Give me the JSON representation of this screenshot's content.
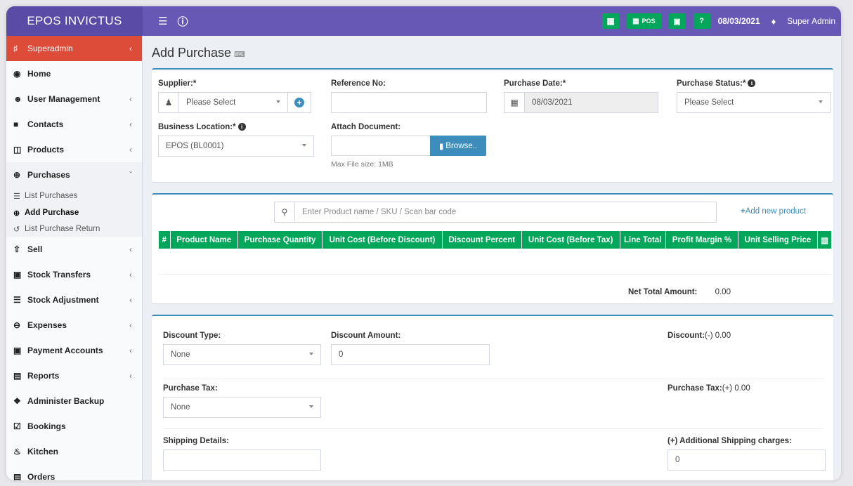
{
  "app": {
    "brand": "EPOS INVICTUS",
    "menu_icon": "hamburger-icon",
    "info_icon": "info-icon"
  },
  "topbar": {
    "calculator_icon": "calculator-icon",
    "pos_label": "POS",
    "cash_icon": "cash-icon",
    "help_icon": "question-icon",
    "date": "08/03/2021",
    "bell_icon": "bell-icon",
    "user": "Super Admin",
    "colors": {
      "bar": "#6758b6",
      "brand": "#5a4ba6",
      "button": "#00a65a"
    }
  },
  "sidebar": {
    "active": "Superadmin",
    "items": [
      {
        "label": "Home",
        "icon": "dashboard-icon",
        "chevron": false
      },
      {
        "label": "User Management",
        "icon": "users-icon",
        "chevron": true
      },
      {
        "label": "Contacts",
        "icon": "address-book-icon",
        "chevron": true
      },
      {
        "label": "Products",
        "icon": "cubes-icon",
        "chevron": true
      },
      {
        "label": "Purchases",
        "icon": "plus-circle-icon",
        "chevron": true,
        "open": true
      }
    ],
    "purchases_sub": [
      "List Purchases",
      "Add Purchase",
      "List Purchase Return"
    ],
    "items2": [
      {
        "label": "Sell",
        "icon": "arrow-circle-up-icon",
        "chevron": true
      },
      {
        "label": "Stock Transfers",
        "icon": "truck-icon",
        "chevron": true
      },
      {
        "label": "Stock Adjustment",
        "icon": "database-icon",
        "chevron": true
      },
      {
        "label": "Expenses",
        "icon": "minus-circle-icon",
        "chevron": true
      },
      {
        "label": "Payment Accounts",
        "icon": "money-icon",
        "chevron": true
      },
      {
        "label": "Reports",
        "icon": "bar-chart-icon",
        "chevron": true
      },
      {
        "label": "Administer Backup",
        "icon": "backup-icon",
        "chevron": false
      },
      {
        "label": "Bookings",
        "icon": "calendar-check-icon",
        "chevron": false
      },
      {
        "label": "Kitchen",
        "icon": "fire-icon",
        "chevron": false
      },
      {
        "label": "Orders",
        "icon": "list-alt-icon",
        "chevron": false
      }
    ],
    "active_color": "#dd4b39"
  },
  "page": {
    "title": "Add Purchase",
    "title_icon": "keyboard-icon"
  },
  "form": {
    "supplier_label": "Supplier:*",
    "supplier_value": "Please Select",
    "reference_label": "Reference No:",
    "reference_value": "",
    "purchase_date_label": "Purchase Date:*",
    "purchase_date_value": "08/03/2021",
    "purchase_status_label": "Purchase Status:*",
    "purchase_status_value": "Please Select",
    "business_location_label": "Business Location:*",
    "business_location_value": "EPOS (BL0001)",
    "attach_label": "Attach Document:",
    "browse_label": "Browse..",
    "max_file_size": "Max File size: 1MB"
  },
  "products": {
    "search_placeholder": "Enter Product name / SKU / Scan bar code",
    "add_new": "Add new product",
    "columns": [
      "#",
      "Product Name",
      "Purchase Quantity",
      "Unit Cost (Before Discount)",
      "Discount Percent",
      "Unit Cost (Before Tax)",
      "Line Total",
      "Profit Margin %",
      "Unit Selling Price"
    ],
    "net_total_label": "Net Total Amount:",
    "net_total_value": "0.00"
  },
  "totals": {
    "discount_type_label": "Discount Type:",
    "discount_type_value": "None",
    "discount_amount_label": "Discount Amount:",
    "discount_amount_value": "0",
    "discount_summary_label": "Discount:",
    "discount_summary_value": "(-) 0.00",
    "purchase_tax_label": "Purchase Tax:",
    "purchase_tax_value": "None",
    "purchase_tax_summary_label": "Purchase Tax:",
    "purchase_tax_summary_value": "(+) 0.00",
    "shipping_details_label": "Shipping Details:",
    "shipping_details_value": "",
    "shipping_charges_label": "(+) Additional Shipping charges:",
    "shipping_charges_value": "0"
  }
}
